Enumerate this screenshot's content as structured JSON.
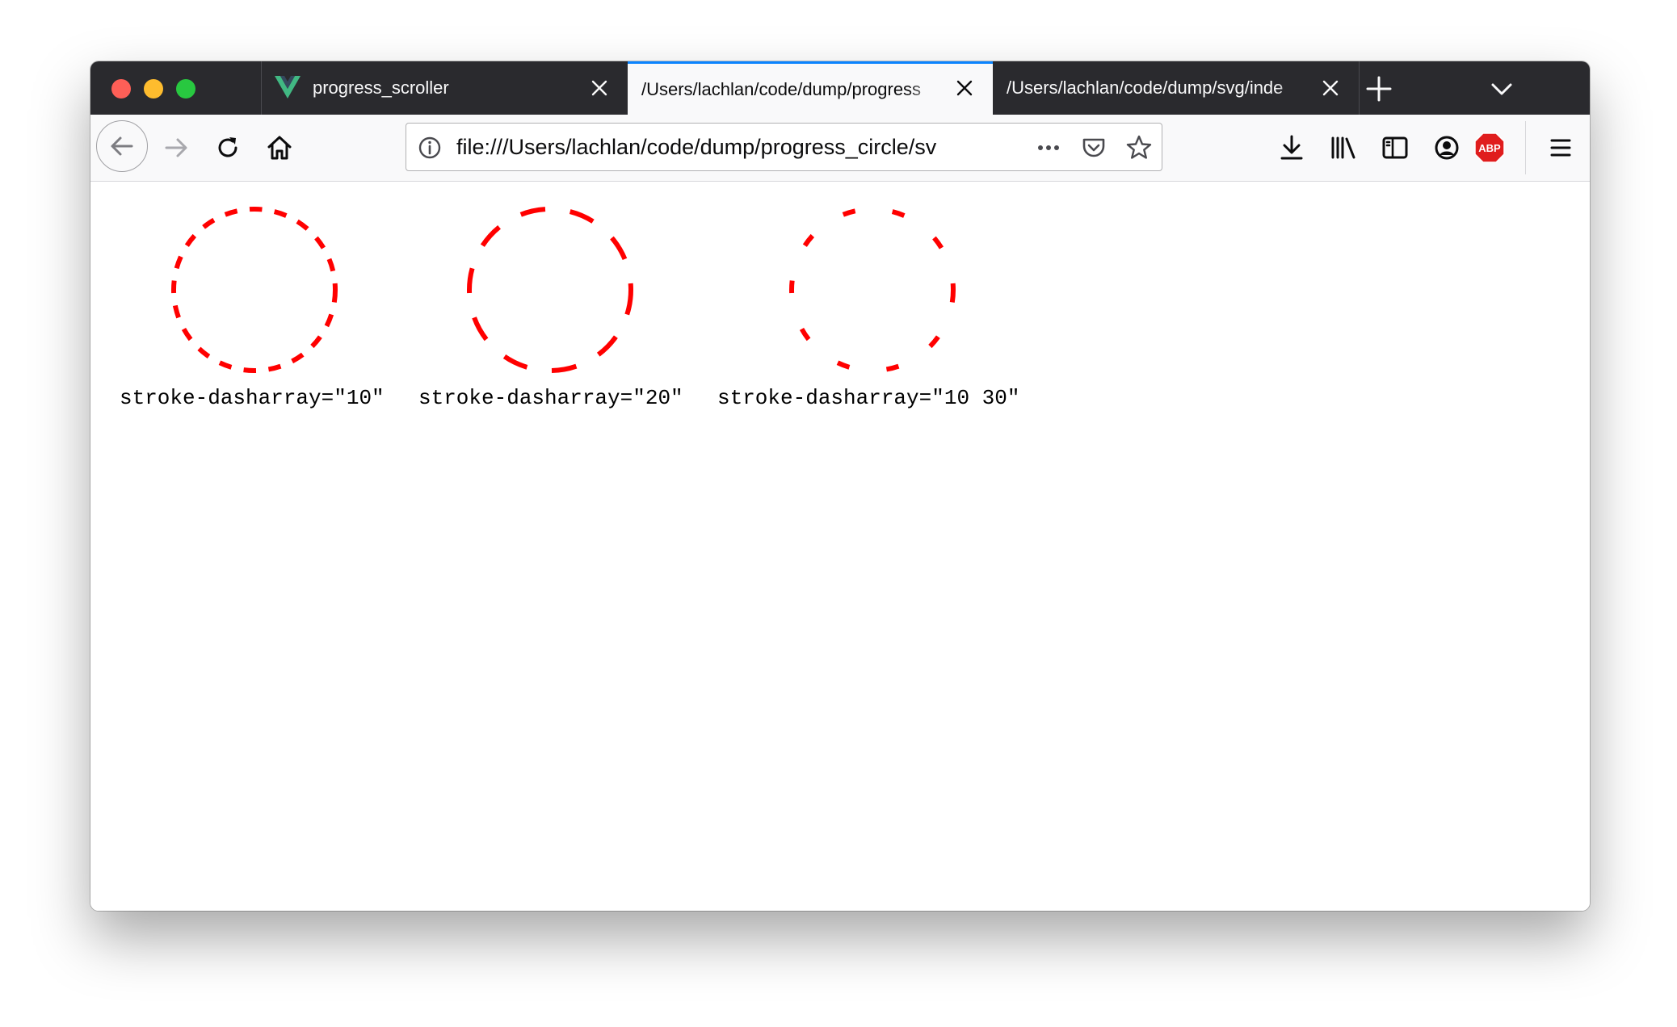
{
  "window": {
    "traffic_lights": {
      "close_color": "#fe5f57",
      "minimize_color": "#febc2e",
      "maximize_color": "#28c840"
    }
  },
  "tabs": [
    {
      "title": "progress_scroller",
      "icon": "vue-logo-icon",
      "active": false
    },
    {
      "title": "/Users/lachlan/code/dump/progress",
      "active": true
    },
    {
      "title": "/Users/lachlan/code/dump/svg/inde",
      "active": false
    }
  ],
  "toolbar": {
    "url": "file:///Users/lachlan/code/dump/progress_circle/sv",
    "icons": [
      "back-arrow-icon",
      "forward-arrow-icon",
      "reload-icon",
      "home-icon",
      "info-icon",
      "more-dots-icon",
      "pocket-icon",
      "bookmark-star-icon",
      "download-icon",
      "library-icon",
      "sidebar-icon",
      "account-icon",
      "adblock-plus-icon",
      "menu-icon"
    ],
    "abp_label": "ABP"
  },
  "content": {
    "stroke_color": "#ff0000",
    "demos": [
      {
        "caption": "stroke-dasharray=\"10\"",
        "dasharray": "10"
      },
      {
        "caption": "stroke-dasharray=\"20\"",
        "dasharray": "20"
      },
      {
        "caption": "stroke-dasharray=\"10 30\"",
        "dasharray": "10 30"
      }
    ]
  }
}
